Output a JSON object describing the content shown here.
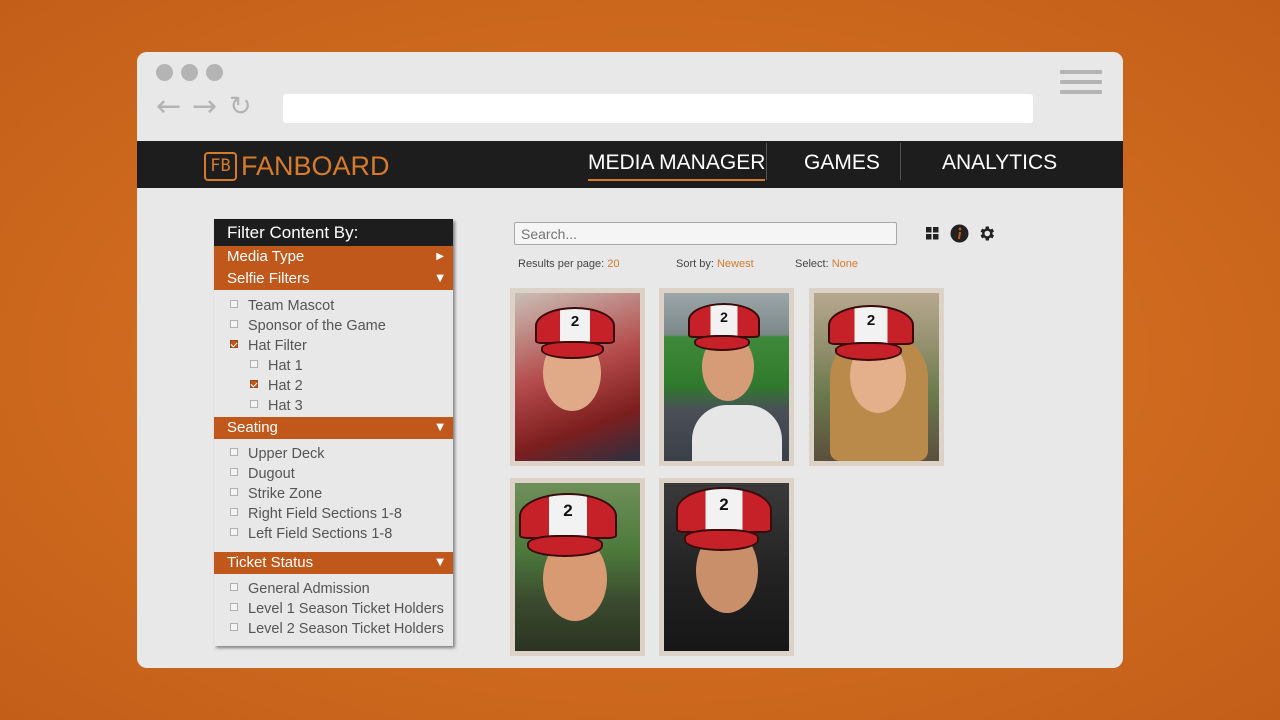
{
  "brand": {
    "logo_mark": "FB",
    "name": "FANBOARD",
    "accent": "#d87a2c"
  },
  "nav": {
    "items": [
      {
        "label": "MEDIA MANAGER",
        "active": true
      },
      {
        "label": "GAMES",
        "active": false
      },
      {
        "label": "ANALYTICS",
        "active": false
      }
    ]
  },
  "filters": {
    "title": "Filter Content By:",
    "media_type": "Media Type",
    "selfie_filters": "Selfie Filters",
    "selfie_options": [
      {
        "label": "Team Mascot",
        "checked": false
      },
      {
        "label": "Sponsor of the Game",
        "checked": false
      },
      {
        "label": "Hat Filter",
        "checked": true
      }
    ],
    "hat_options": [
      {
        "label": "Hat 1",
        "checked": false
      },
      {
        "label": "Hat 2",
        "checked": true
      },
      {
        "label": "Hat 3",
        "checked": false
      }
    ],
    "seating": "Seating",
    "seating_options": [
      {
        "label": "Upper Deck",
        "checked": false
      },
      {
        "label": "Dugout",
        "checked": false
      },
      {
        "label": "Strike Zone",
        "checked": false
      },
      {
        "label": "Right Field Sections 1-8",
        "checked": false
      },
      {
        "label": "Left Field Sections 1-8",
        "checked": false
      }
    ],
    "ticket_status": "Ticket Status",
    "ticket_options": [
      {
        "label": "General Admission",
        "checked": false
      },
      {
        "label": "Level 1 Season Ticket Holders",
        "checked": false
      },
      {
        "label": "Level 2 Season Ticket Holders",
        "checked": false
      }
    ]
  },
  "search": {
    "placeholder": "Search..."
  },
  "toolbar": {
    "icons": [
      "grid-view-icon",
      "info-icon",
      "gear-icon"
    ]
  },
  "results": {
    "per_page_label": "Results per page:",
    "per_page_value": "20",
    "sort_label": "Sort by:",
    "sort_value": "Newest",
    "select_label": "Select:",
    "select_value": "None"
  },
  "media": [
    {
      "hat_number": "2"
    },
    {
      "hat_number": "2"
    },
    {
      "hat_number": "2"
    },
    {
      "hat_number": "2"
    },
    {
      "hat_number": "2"
    }
  ]
}
